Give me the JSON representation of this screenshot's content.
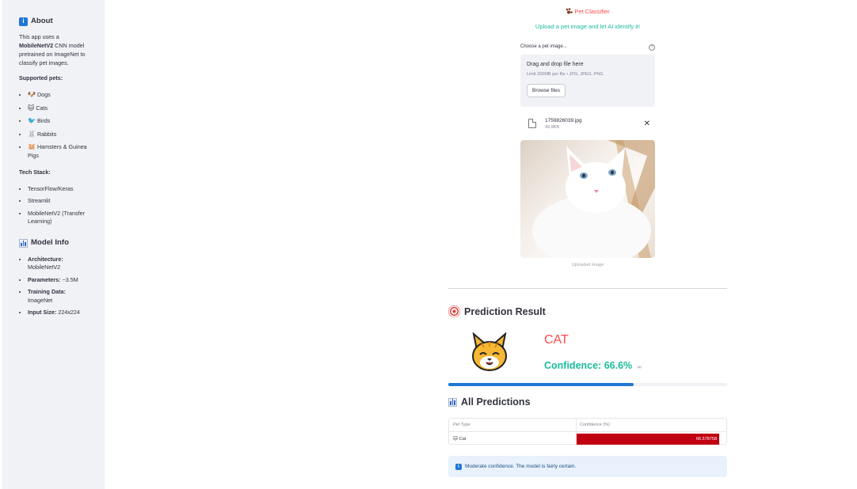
{
  "sidebar": {
    "about_title": "About",
    "about_text_pre": "This app uses a ",
    "about_text_bold": "MobileNetV2",
    "about_text_post": " CNN model pretrained on ImageNet to classify pet images.",
    "supported_title": "Supported pets:",
    "pets": [
      {
        "emoji": "🐶",
        "label": "Dogs"
      },
      {
        "emoji": "🐱",
        "label": "Cats"
      },
      {
        "emoji": "🐦",
        "label": "Birds"
      },
      {
        "emoji": "🐰",
        "label": "Rabbits"
      },
      {
        "emoji": "🐹",
        "label": "Hamsters & Guinea Pigs"
      }
    ],
    "tech_title": "Tech Stack:",
    "tech": [
      "TensorFlow/Keras",
      "Streamlit",
      "MobileNetV2 (Transfer Learning)"
    ],
    "model_title": "Model Info",
    "model_info": [
      {
        "key": "Architecture:",
        "value": "MobileNetV2"
      },
      {
        "key": "Parameters:",
        "value": "~3.5M"
      },
      {
        "key": "Training Data:",
        "value": "ImageNet"
      },
      {
        "key": "Input Size:",
        "value": "224x224"
      }
    ]
  },
  "header": {
    "title": "Pet Classifier",
    "subtitle": "Upload a pet image and let AI identify it!"
  },
  "uploader": {
    "label": "Choose a pet image...",
    "drop_text": "Drag and drop file here",
    "limit_text": "Limit 200MB per file • JPG, JPEG, PNG",
    "browse_label": "Browse files",
    "file_name": "1759826039.jpg",
    "file_size": "43.9KB",
    "image_caption": "Uploaded Image"
  },
  "result": {
    "section_title": "Prediction Result",
    "predicted_label": "CAT",
    "confidence_text": "Confidence: 66.6%",
    "confidence_fraction": 0.666
  },
  "predictions": {
    "section_title": "All Predictions",
    "columns": [
      "Pet Type",
      "Confidence (%)"
    ],
    "rows": [
      {
        "emoji": "🐱",
        "pet": "Cat",
        "confidence": "66.578758"
      }
    ]
  },
  "info": {
    "message": "Moderate confidence. The model is fairly certain."
  },
  "colors": {
    "title_red": "#ff4b4b",
    "teal": "#1abc9c",
    "progress_blue": "#1f77d4",
    "bar_red": "#c10012"
  }
}
